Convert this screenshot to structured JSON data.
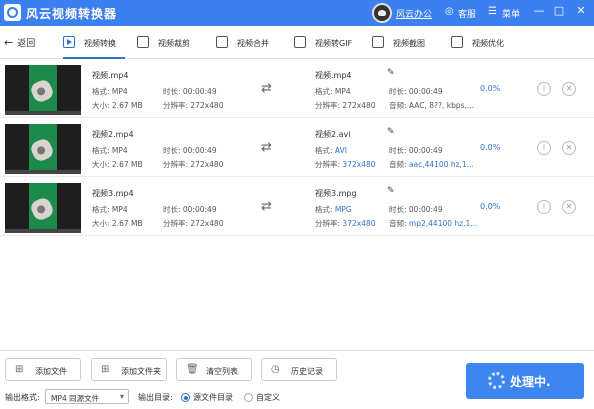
{
  "app": {
    "title": "风云视频转换器",
    "brand": "风云办公",
    "service": "客服",
    "menu": "菜单",
    "min": "—",
    "max": "□",
    "close": "✕"
  },
  "nav": {
    "back": "返回",
    "tabs": [
      {
        "label": "视频转换",
        "active": true
      },
      {
        "label": "视频裁剪"
      },
      {
        "label": "视频合并"
      },
      {
        "label": "视频转GIF"
      },
      {
        "label": "视频截图"
      },
      {
        "label": "视频优化"
      }
    ]
  },
  "files": [
    {
      "src": {
        "name": "视频.mp4",
        "format_label": "格式: MP4",
        "duration_label": "时长: 00:00:49",
        "size_label": "大小: 2.67 MB",
        "resolution_label": "分辨率: 272x480"
      },
      "out": {
        "name": "视频.mp4",
        "format_key": "格式: ",
        "format_val": "MP4",
        "duration_label": "时长: 00:00:49",
        "res_key": "分辨率: ",
        "res_val": "272x480",
        "audio_key": "音频: ",
        "audio_val": "AAC, 8??, kbps,..."
      },
      "progress": "0.0%"
    },
    {
      "src": {
        "name": "视频2.mp4",
        "format_label": "格式: MP4",
        "duration_label": "时长: 00:00:49",
        "size_label": "大小: 2.67 MB",
        "resolution_label": "分辨率: 272x480"
      },
      "out": {
        "name": "视频2.avi",
        "format_key": "格式: ",
        "format_val": "AVI",
        "duration_label": "时长: 00:00:49",
        "res_key": "分辨率: ",
        "res_val": "372x480",
        "audio_key": "音频: ",
        "audio_val": "aac,44100 hz,1..."
      },
      "progress": "0.0%"
    },
    {
      "src": {
        "name": "视频3.mp4",
        "format_label": "格式: MP4",
        "duration_label": "时长: 00:00:49",
        "size_label": "大小: 2.67 MB",
        "resolution_label": "分辨率: 272x480"
      },
      "out": {
        "name": "视频3.mpg",
        "format_key": "格式: ",
        "format_val": "MPG",
        "duration_label": "时长: 00:00:49",
        "res_key": "分辨率: ",
        "res_val": "372x480",
        "audio_key": "音频: ",
        "audio_val": "mp2,44100 hz,1..."
      },
      "progress": "0.0%"
    }
  ],
  "bottom": {
    "add_file": "添加文件",
    "add_folder": "添加文件夹",
    "clear_list": "清空列表",
    "history": "历史记录",
    "output_format_label": "输出格式:",
    "output_format_value": "MP4 同源文件",
    "output_dir_label": "输出目录:",
    "dir_source": "源文件目录",
    "dir_custom": "自定义",
    "process_label": "处理中."
  },
  "colors": {
    "titlebar": "#3b7ff0",
    "accent": "#2c73d2",
    "process_button": "#3d86f0"
  }
}
